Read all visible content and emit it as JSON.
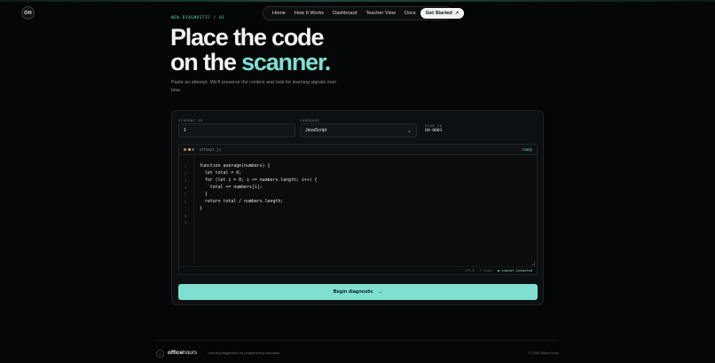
{
  "logo": {
    "text": "OH"
  },
  "nav": {
    "items": [
      "Home",
      "How It Works",
      "Dashboard",
      "Teacher View",
      "Docs"
    ],
    "cta_label": "Get Started",
    "cta_arrow": "↗"
  },
  "hero": {
    "eyebrow": "NEW DIAGNOSTIC / 01",
    "title_line1": "Place the code",
    "title_line2_plain": "on the ",
    "title_line2_accent": "scanner.",
    "subtitle": "Paste an attempt. We'll preserve the context and look for learning signals over time."
  },
  "form": {
    "student_id_label": "STUDENT ID",
    "student_id_value": "1",
    "language_label": "LANGUAGE",
    "language_value": "JavaScript",
    "scan_id_label": "SCAN ID",
    "scan_id_value": "OH-0001"
  },
  "editor": {
    "filename": "attempt.js",
    "status": "ready",
    "line_numbers": [
      "1",
      "2",
      "3",
      "4",
      "5",
      "6",
      "7",
      "8",
      "9"
    ],
    "code_lines": [
      "function average(numbers) {",
      "  let total = 0;",
      "  for (let i = 0; i <= numbers.length; i++) {",
      "    total += numbers[i];",
      "  }",
      "  return total / numbers.length;",
      "}",
      "",
      ""
    ],
    "footer_encoding": "UTF-8",
    "footer_lines": "7 lines",
    "footer_status": "scanner connected"
  },
  "begin_button": {
    "label": "Begin diagnostic",
    "arrow": "→"
  },
  "footer": {
    "brand_bold": "office",
    "brand_thin": "hours",
    "tagline": "Learning diagnostics for programming education.",
    "copyright": "© 2026 Office Hours"
  },
  "colors": {
    "accent": "#7fe0cf",
    "background": "#050607",
    "panel": "#0d1012"
  }
}
